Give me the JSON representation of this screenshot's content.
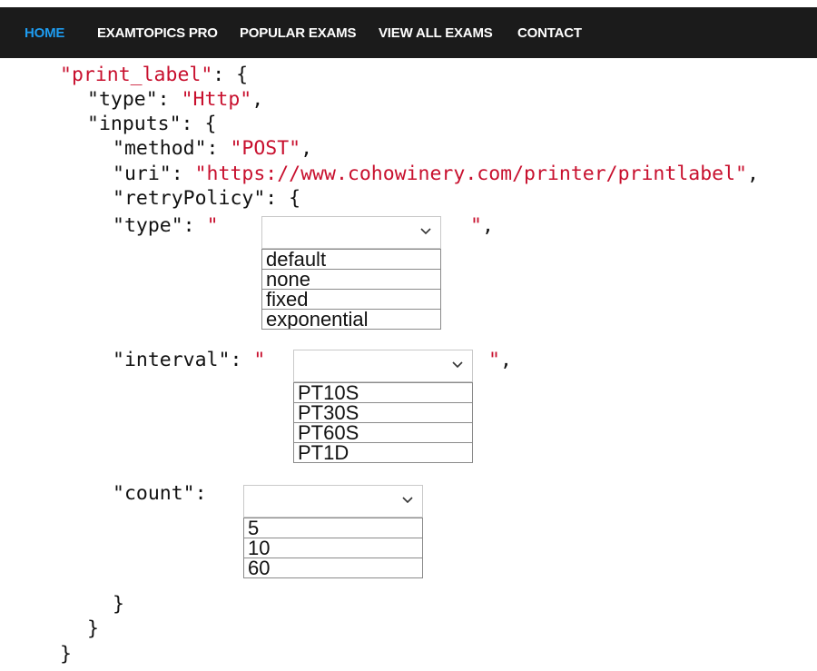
{
  "nav": {
    "items": [
      {
        "label": "HOME"
      },
      {
        "label": "EXAMTOPICS PRO"
      },
      {
        "label": "POPULAR EXAMS"
      },
      {
        "label": "VIEW ALL EXAMS"
      },
      {
        "label": "CONTACT"
      }
    ]
  },
  "code": {
    "l1_key": "\"print_label\"",
    "l1_rest": ": {",
    "l2_key": "\"type\": ",
    "l2_val": "\"Http\"",
    "l2_end": ",",
    "l3": "\"inputs\": {",
    "l4_key": "\"method\": ",
    "l4_val": "\"POST\"",
    "l4_end": ",",
    "l5_key": "\"uri\": ",
    "l5_val": "\"https://www.cohowinery.com/printer/printlabel\"",
    "l5_end": ",",
    "l6": "\"retryPolicy\": {",
    "type_key": "\"type\": ",
    "type_open": "\"",
    "type_close_q": "\"",
    "type_close": ",",
    "interval_key": "\"interval\": ",
    "interval_open": "\"",
    "interval_close_q": "\"",
    "interval_close": ",",
    "count_key": "\"count\":",
    "brace1": "}",
    "brace2": "}",
    "brace3": "}"
  },
  "dropdowns": {
    "type_options": [
      "default",
      "none",
      "fixed",
      "exponential"
    ],
    "interval_options": [
      "PT10S",
      "PT30S",
      "PT60S",
      "PT1D"
    ],
    "count_options": [
      "5",
      "10",
      "60"
    ]
  },
  "colors": {
    "navbar_bg": "#1b1b1b",
    "nav_active": "#1e9cf0",
    "string": "#c8102e"
  }
}
